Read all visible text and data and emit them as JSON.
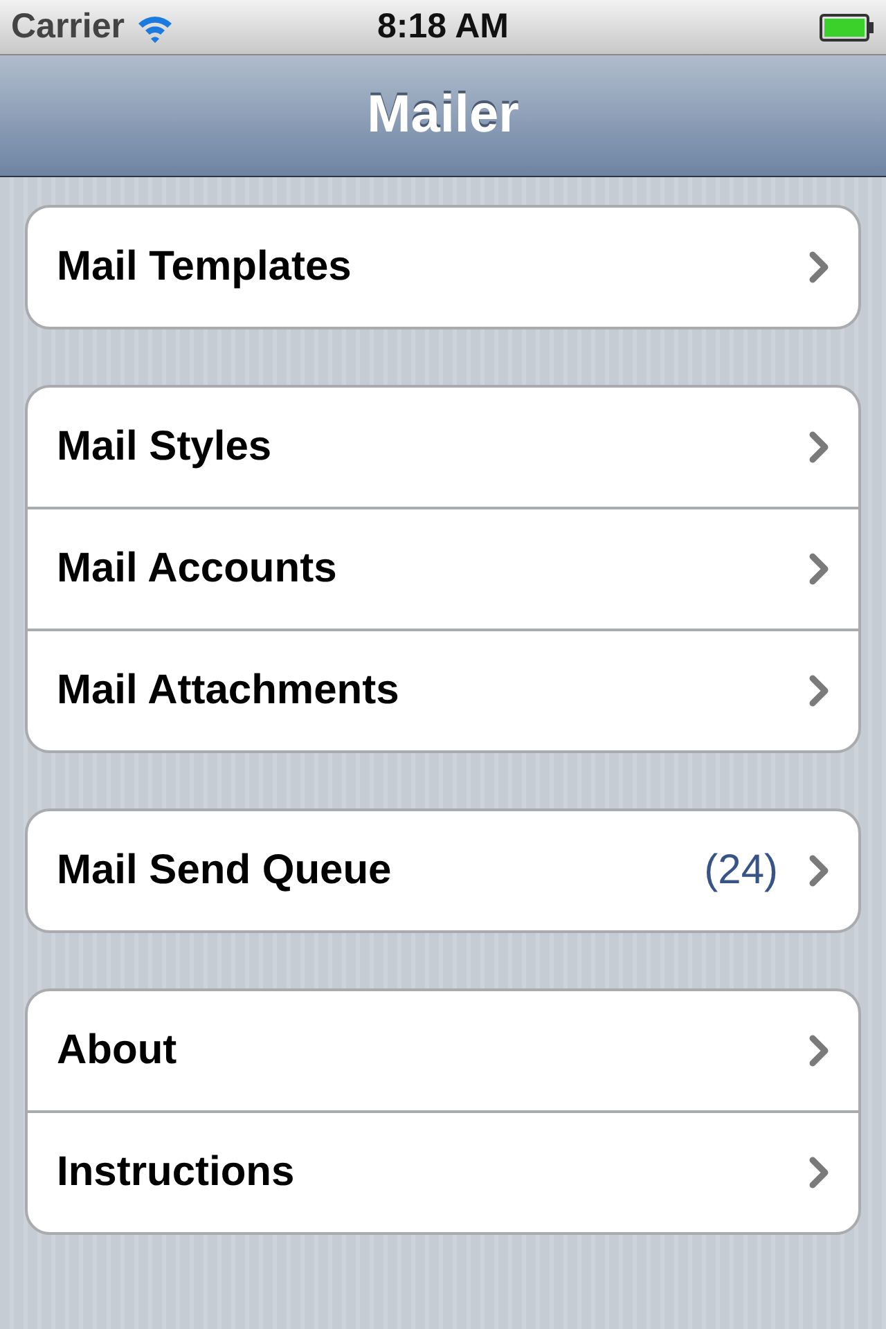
{
  "status_bar": {
    "carrier": "Carrier",
    "time": "8:18 AM"
  },
  "nav_bar": {
    "title": "Mailer"
  },
  "groups": [
    {
      "rows": [
        {
          "label": "Mail Templates"
        }
      ]
    },
    {
      "rows": [
        {
          "label": "Mail Styles"
        },
        {
          "label": "Mail Accounts"
        },
        {
          "label": "Mail Attachments"
        }
      ]
    },
    {
      "rows": [
        {
          "label": "Mail Send Queue",
          "detail": "(24)"
        }
      ]
    },
    {
      "rows": [
        {
          "label": "About"
        },
        {
          "label": "Instructions"
        }
      ]
    }
  ]
}
